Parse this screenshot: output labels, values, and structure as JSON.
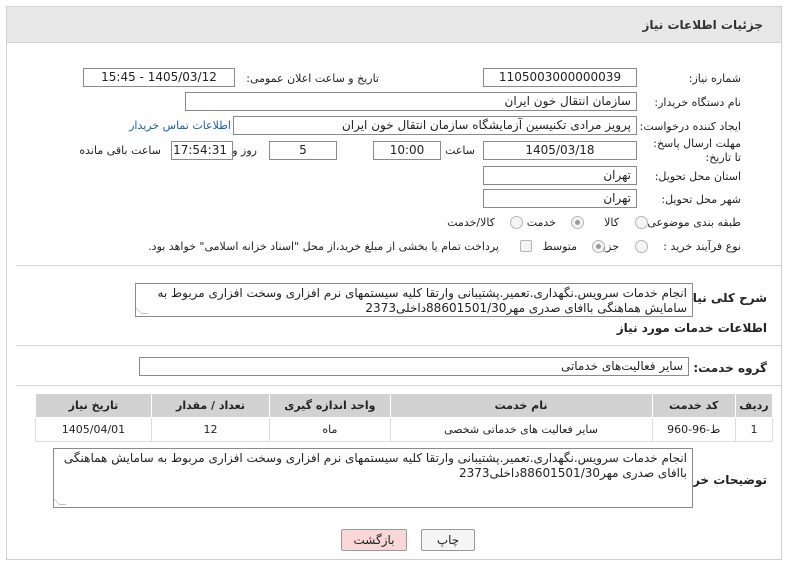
{
  "header": {
    "title": "جزئیات اطلاعات نیاز"
  },
  "labels": {
    "need_number": "شماره نیاز:",
    "announce_datetime": "تاریخ و ساعت اعلان عمومی:",
    "buyer_org": "نام دستگاه خریدار:",
    "requester": "ایجاد کننده درخواست:",
    "buyer_contact_link": "اطلاعات تماس خریدار",
    "deadline": "مهلت ارسال پاسخ: تا تاریخ:",
    "time_word": "ساعت",
    "day_and": "روز و",
    "remaining": "ساعت باقی مانده",
    "delivery_province": "استان محل تحویل:",
    "delivery_city": "شهر محل تحویل:",
    "category": "طبقه بندی موضوعی:",
    "purchase_type": "نوع فرآیند خرید :",
    "need_summary": "شرح کلی نیاز:",
    "services_section": "اطلاعات خدمات مورد نیاز",
    "service_group": "گروه خدمت:",
    "buyer_notes": "توضیحات خریدار:"
  },
  "values": {
    "need_number": "1105003000000039",
    "announce_datetime": "1405/03/12 - 15:45",
    "buyer_org": "سازمان انتقال خون ایران",
    "requester": "پرویز مرادی تکنیسین آزمایشگاه سازمان انتقال خون ایران",
    "deadline_date": "1405/03/18",
    "deadline_time": "10:00",
    "days": "5",
    "remaining_time": "17:54:31",
    "province": "تهران",
    "city": "تهران",
    "service_group": "سایر فعالیت‌های خدماتی",
    "need_summary": "انجام خدمات سرویس.نگهداری.تعمیر.پشتیبانی وارتقا کلیه سیستمهای نرم افزاری وسخت افزاری مربوط به سامایش هماهنگی باافای صدری مهر88601501/30داخلی2373",
    "buyer_notes": "انجام خدمات سرویس.نگهداری.تعمیر.پشتیبانی وارتقا کلیه سیستمهای نرم افزاری وسخت افزاری مربوط به سامایش هماهنگی باافای صدری مهر88601501/30داخلی2373"
  },
  "category_options": [
    {
      "label": "کالا",
      "selected": false
    },
    {
      "label": "خدمت",
      "selected": true
    },
    {
      "label": "کالا/خدمت",
      "selected": false
    }
  ],
  "purchase_options": [
    {
      "label": "جزیی",
      "selected": false
    },
    {
      "label": "متوسط",
      "selected": true
    }
  ],
  "payment_note": "پرداخت تمام یا بخشی از مبلغ خرید،از محل \"اسناد خزانه اسلامی\" خواهد بود.",
  "table": {
    "headers": [
      "ردیف",
      "کد خدمت",
      "نام خدمت",
      "واحد اندازه گیری",
      "تعداد / مقدار",
      "تاریخ نیاز"
    ],
    "rows": [
      [
        "1",
        "ط-96-960",
        "سایر فعالیت های خدماتی شخصی",
        "ماه",
        "12",
        "1405/04/01"
      ]
    ]
  },
  "buttons": {
    "print": "چاپ",
    "back": "بازگشت"
  },
  "colors": {
    "header_bg": "#e8e8e8",
    "table_header_bg": "#d2d2d2",
    "link": "#1a5fb4",
    "back_button_bg": "#f9d7d7"
  }
}
